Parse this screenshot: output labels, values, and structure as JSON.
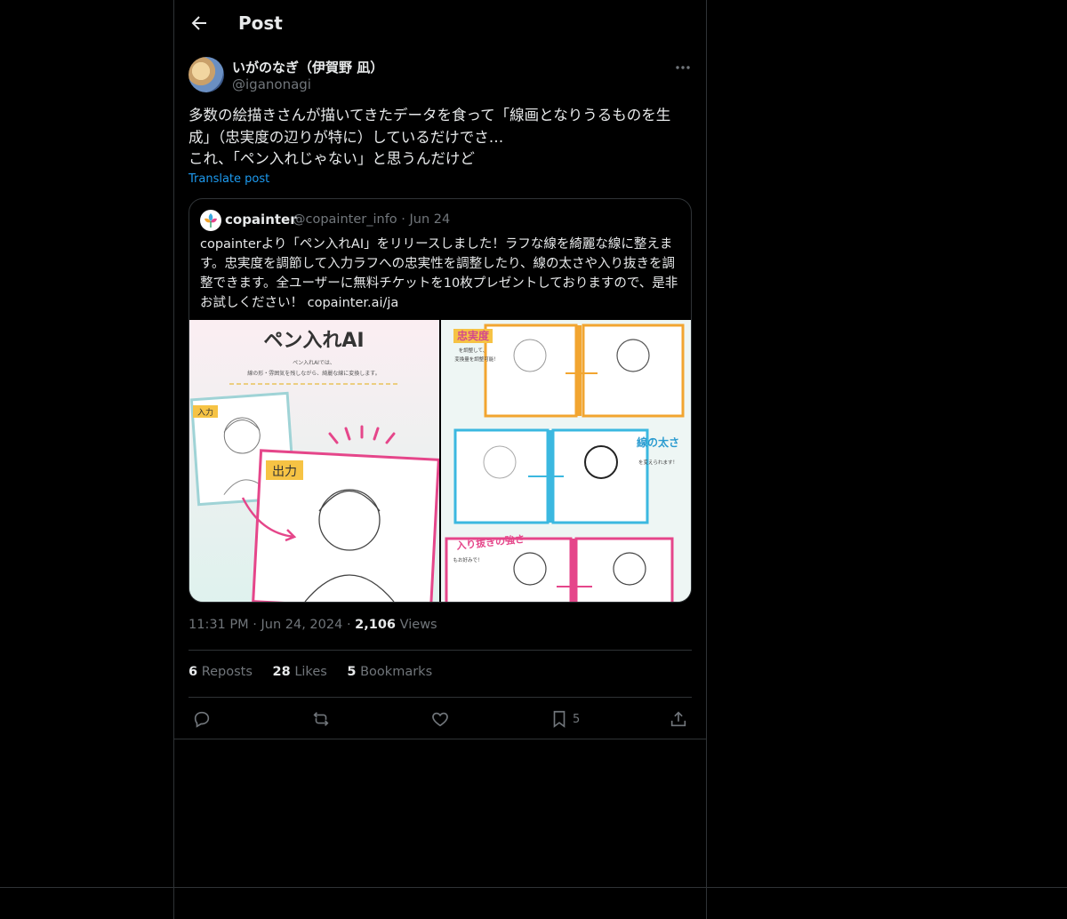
{
  "header": {
    "title": "Post"
  },
  "author": {
    "name": "いがのなぎ（伊賀野 凪）",
    "handle": "@iganonagi"
  },
  "post": {
    "text": "多数の絵描きさんが描いてきたデータを食って「線画となりうるものを生成」（忠実度の辺りが特に）しているだけでさ…\nこれ、「ペン入れじゃない」と思うんだけど",
    "translate_label": "Translate post"
  },
  "quote": {
    "name": "copainter",
    "handle": "@copainter_info · Jun 24",
    "text": "copainterより「ペン入れAI」をリリースしました！ラフな線を綺麗な線に整えます。忠実度を調節して入力ラフへの忠実性を調整したり、線の太さや入り抜きを調整できます。全ユーザーに無料チケットを10枚プレゼントしておりますので、是非お試しください！ copainter.ai/ja",
    "image_left": {
      "title": "ペン入れAI",
      "subtitle": "ペン入れAIでは、\n線の形・雰囲気を残しながら、綺麗な線に変換します。",
      "input_label": "入力",
      "output_label": "出力"
    },
    "image_right": {
      "fidelity_label": "忠実度",
      "fidelity_note": "を調整して、\n変換量を調整可能！",
      "thickness_label": "線の太さ",
      "thickness_note": "を変えられます！",
      "taper_label": "入り抜きの強さ",
      "taper_note": "もお好みで！"
    }
  },
  "meta": {
    "time": "11:31 PM",
    "date": "Jun 24, 2024",
    "views_count": "2,106",
    "views_label": "Views"
  },
  "stats": {
    "reposts_count": "6",
    "reposts_label": "Reposts",
    "likes_count": "28",
    "likes_label": "Likes",
    "bookmarks_count": "5",
    "bookmarks_label": "Bookmarks"
  },
  "actions": {
    "bookmark_count": "5"
  },
  "colors": {
    "background": "#000000",
    "text": "#e7e9ea",
    "muted": "#71767b",
    "link": "#1d9bf0",
    "border": "#2f3336"
  }
}
